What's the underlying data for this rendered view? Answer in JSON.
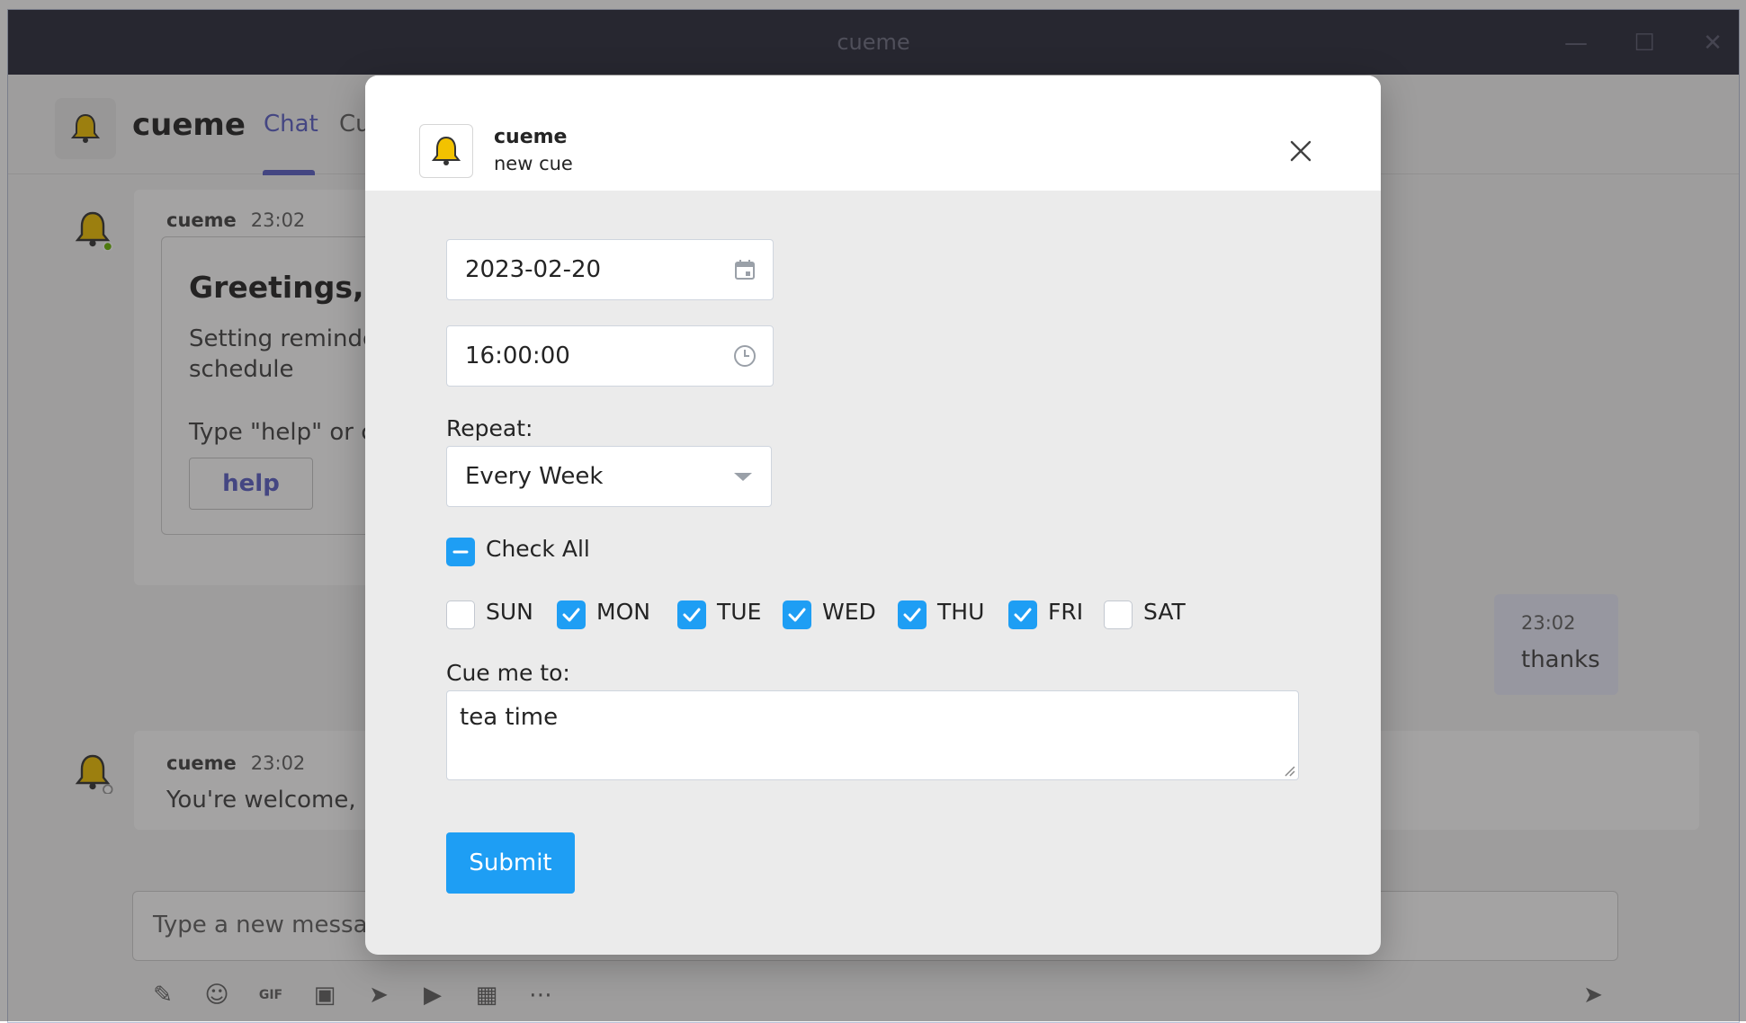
{
  "window": {
    "title": "cueme"
  },
  "app": {
    "name": "cueme",
    "tabs": [
      {
        "label": "Chat"
      },
      {
        "label": "Cu"
      }
    ]
  },
  "chat": {
    "messages": [
      {
        "author": "cueme",
        "time": "23:02",
        "card": {
          "title": "Greetings, I'r",
          "line1": "Setting reminder",
          "line2": "schedule",
          "line3": "Type \"help\" or cli",
          "button_label": "help"
        }
      },
      {
        "author": "cueme",
        "time": "23:02",
        "text": "You're welcome, I'm"
      }
    ],
    "own_message": {
      "time": "23:02",
      "text": "thanks"
    },
    "compose_placeholder": "Type a new message",
    "toolbar_icons": [
      "format-icon",
      "emoji-icon",
      "gif-icon",
      "sticker-icon",
      "schedule-icon",
      "video-icon",
      "image-icon",
      "more-icon",
      "send-icon"
    ]
  },
  "dialog": {
    "app_name": "cueme",
    "subtitle": "new cue",
    "date_value": "2023-02-20",
    "time_value": "16:00:00",
    "repeat_label": "Repeat:",
    "repeat_value": "Every Week",
    "check_all_label": "Check All",
    "days": [
      {
        "label": "SUN",
        "checked": false
      },
      {
        "label": "MON",
        "checked": true
      },
      {
        "label": "TUE",
        "checked": true
      },
      {
        "label": "WED",
        "checked": true
      },
      {
        "label": "THU",
        "checked": true
      },
      {
        "label": "FRI",
        "checked": true
      },
      {
        "label": "SAT",
        "checked": false
      }
    ],
    "cue_label": "Cue me to:",
    "cue_value": "tea time",
    "submit_label": "Submit",
    "accent_color": "#1e9ef4"
  }
}
